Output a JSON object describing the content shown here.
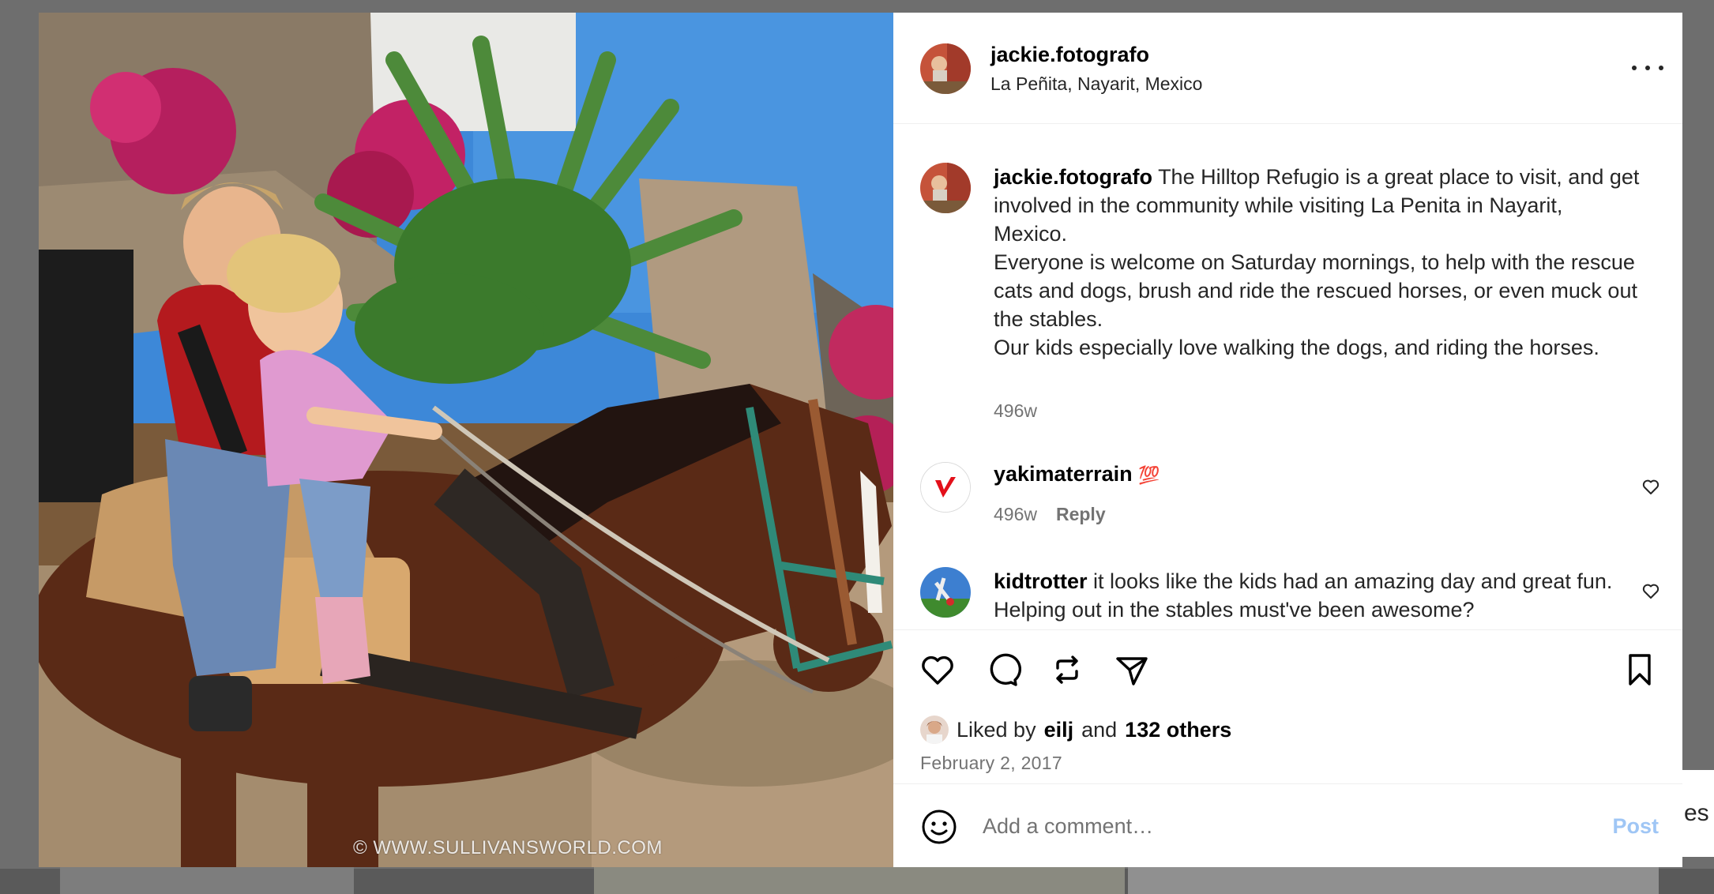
{
  "backdrop": {
    "card_text": "es"
  },
  "photo": {
    "watermark": "© WWW.SULLIVANSWORLD.COM"
  },
  "header": {
    "username": "jackie.fotografo",
    "location": "La Peñita, Nayarit, Mexico"
  },
  "caption": {
    "username": "jackie.fotografo",
    "lines": [
      "The Hilltop Refugio is a great place to visit, and get involved in the community while visiting La Penita in Nayarit, Mexico.",
      "Everyone is welcome on Saturday mornings, to help with the rescue cats and dogs, brush and ride the rescued horses, or even muck out the stables.",
      "Our kids especially love walking the dogs, and riding the horses."
    ],
    "time": "496w"
  },
  "comments": [
    {
      "username": "yakimaterrain",
      "text": "💯",
      "time": "496w",
      "reply_label": "Reply"
    },
    {
      "username": "kidtrotter",
      "text": "it looks like the kids had an amazing day and great fun. Helping out in the stables must've been awesome?"
    }
  ],
  "likes": {
    "prefix": "Liked by",
    "user": "eilj",
    "middle": "and",
    "others": "132 others"
  },
  "date": "February 2, 2017",
  "add_comment": {
    "placeholder": "Add a comment…",
    "post_label": "Post"
  },
  "icons": {
    "more": "more-horizontal-icon",
    "like": "heart-icon",
    "comment": "comment-icon",
    "repost": "repost-icon",
    "share": "share-icon",
    "save": "bookmark-icon",
    "emoji": "emoji-icon"
  },
  "colors": {
    "post_button": "#9fc6f5",
    "secondary_text": "#737373",
    "brand_red": "#e3101a"
  }
}
